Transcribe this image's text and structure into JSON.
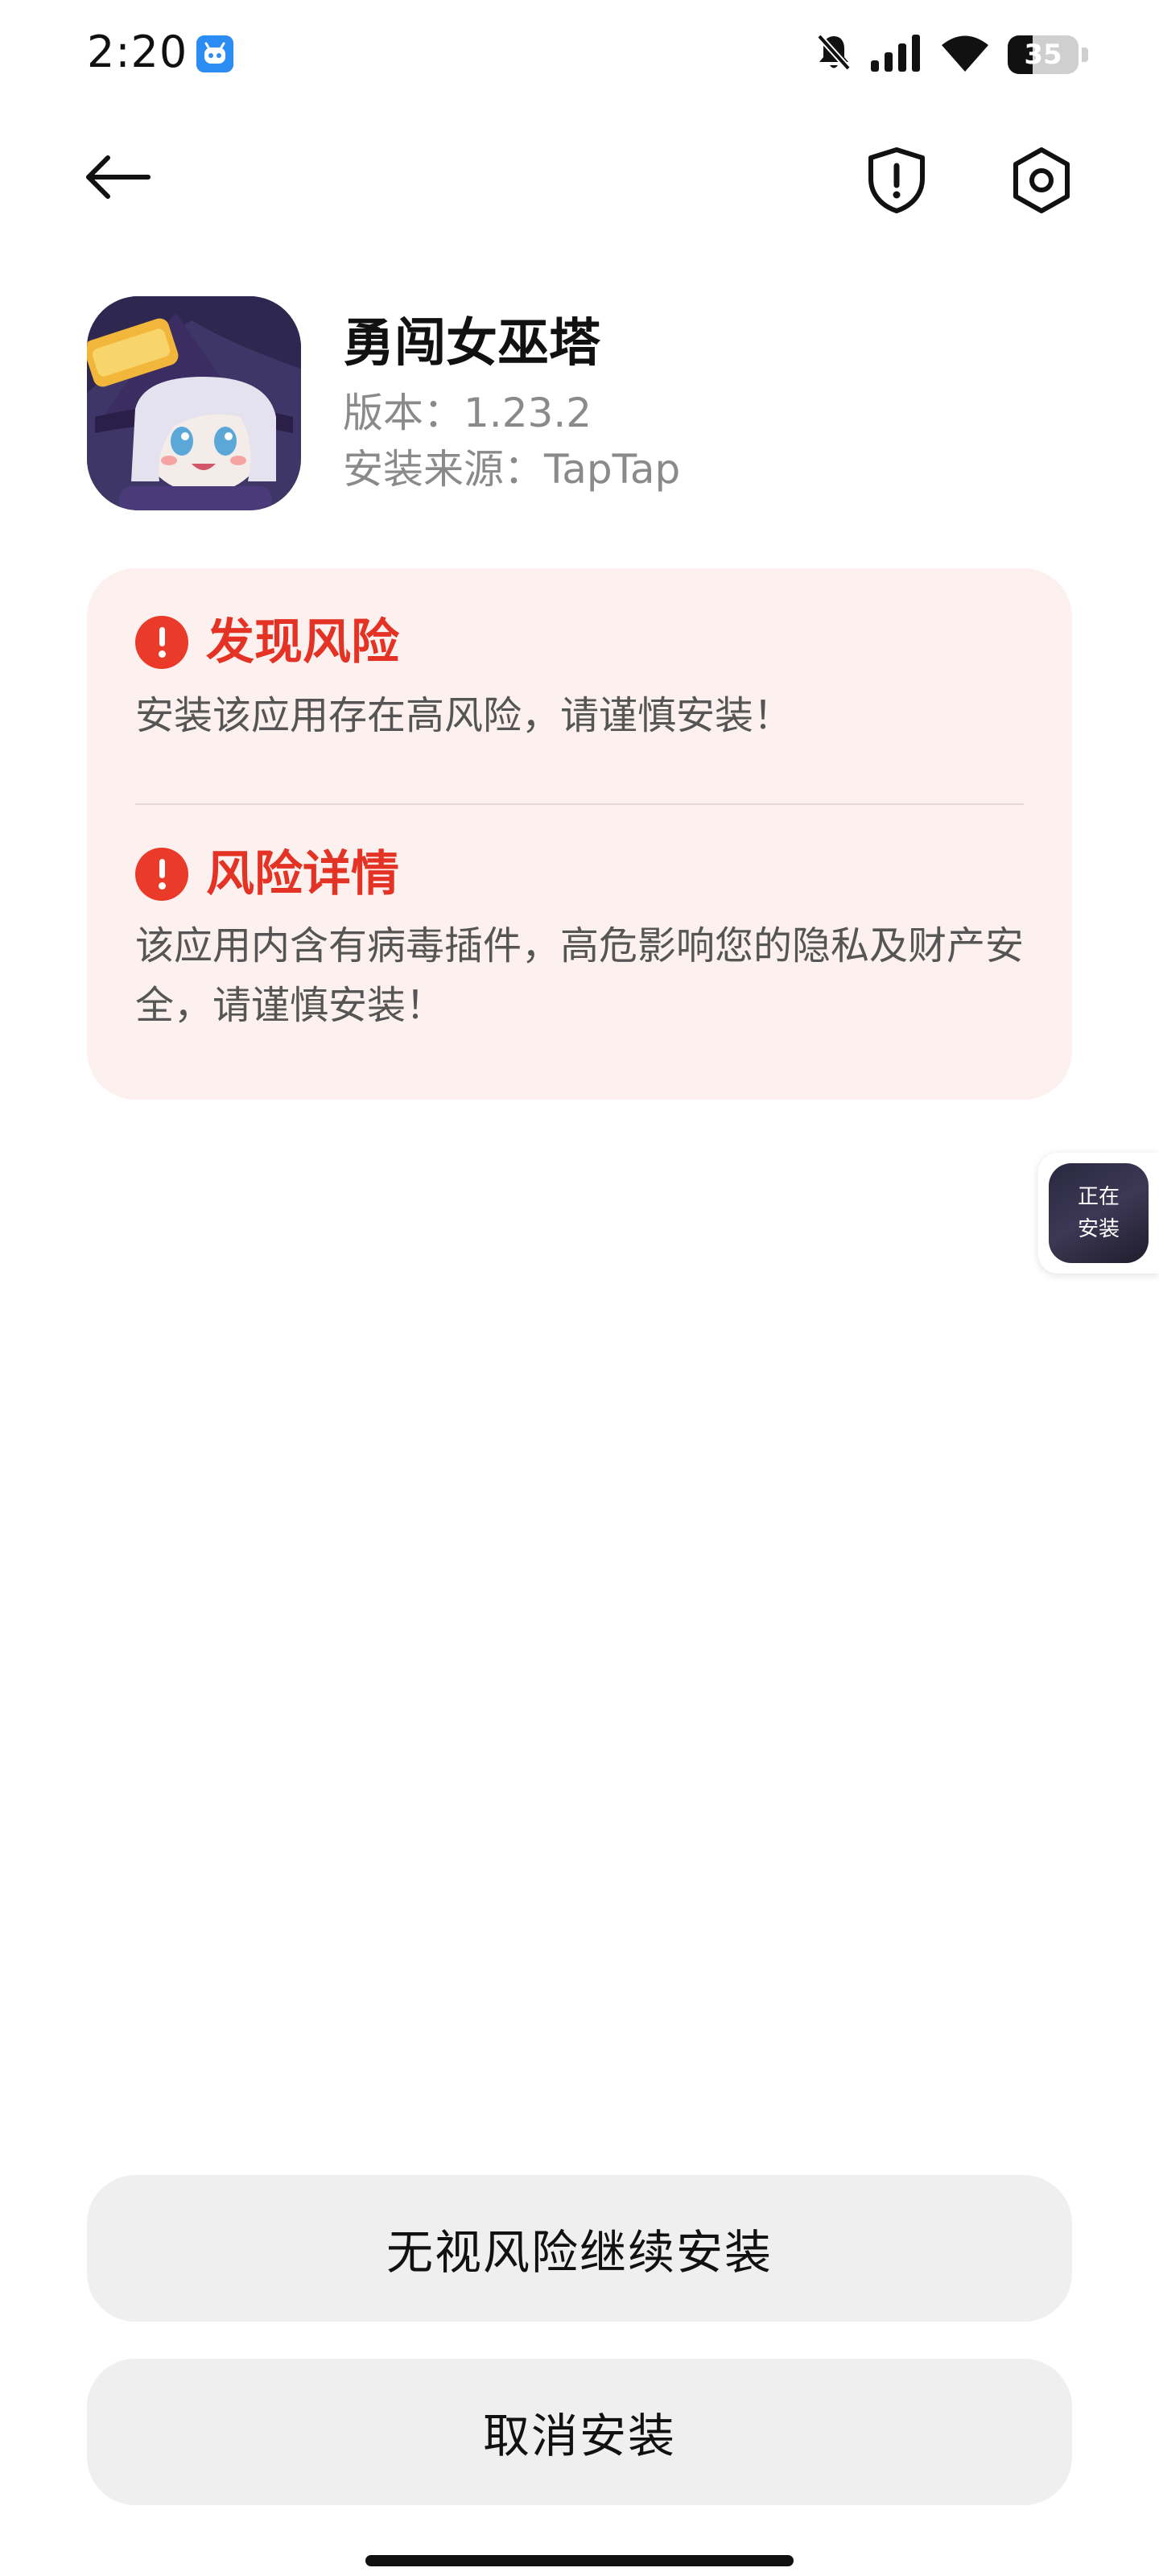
{
  "status_bar": {
    "time": "2:20",
    "battery_level": "35",
    "battery_fraction": 0.35,
    "icons": [
      "app-notification-icon",
      "mute-bell-icon",
      "signal-icon",
      "wifi-icon",
      "battery-icon"
    ]
  },
  "nav": {
    "back_icon": "back-arrow-icon",
    "shield_icon": "security-shield-icon",
    "settings_icon": "settings-gear-icon"
  },
  "app": {
    "name": "勇闯女巫塔",
    "version": "版本：1.23.2",
    "source": "安装来源：TapTap"
  },
  "risk": {
    "found_title": "发现风险",
    "found_desc": "安装该应用存在高风险，请谨慎安装！",
    "detail_title": "风险详情",
    "detail_desc": "该应用内含有病毒插件，高危影响您的隐私及财产安全，请谨慎安装！"
  },
  "installing": {
    "line1": "正在",
    "line2": "安装"
  },
  "buttons": {
    "continue_label": "无视风险继续安装",
    "cancel_label": "取消安装"
  },
  "colors": {
    "risk_red": "#e43325",
    "risk_card_bg": "#fdf1f0",
    "button_bg": "#efefef"
  }
}
